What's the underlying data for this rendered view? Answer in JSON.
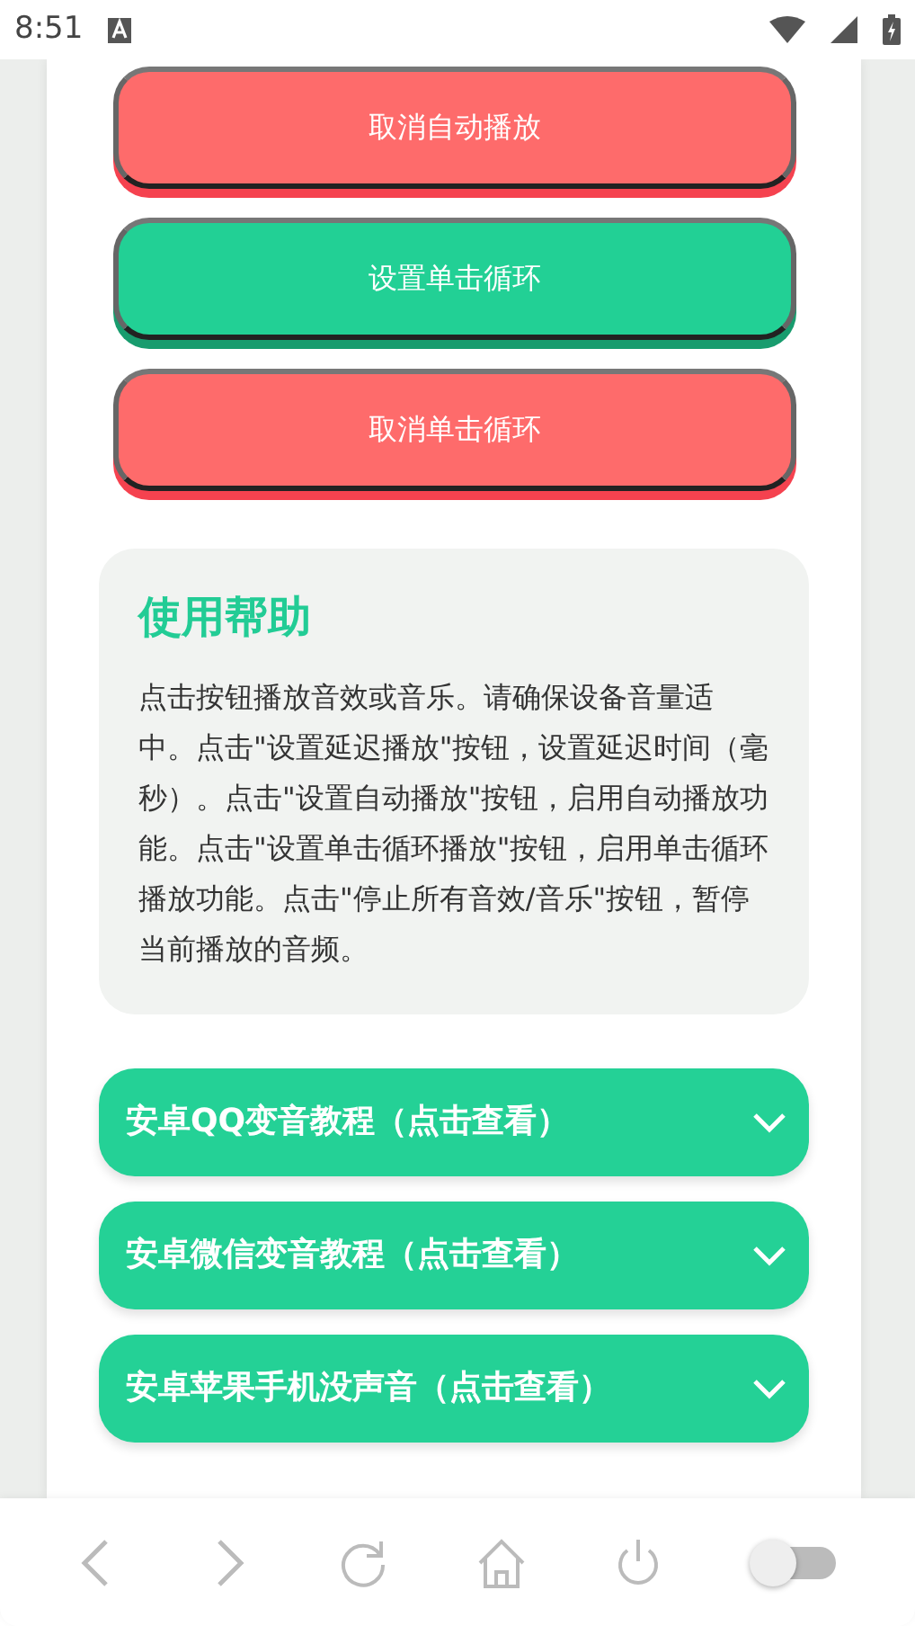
{
  "status_bar": {
    "time": "8:51"
  },
  "buttons": [
    {
      "label": "取消自动播放",
      "kind": "cancel"
    },
    {
      "label": "设置单击循环",
      "kind": "set"
    },
    {
      "label": "取消单击循环",
      "kind": "cancel"
    }
  ],
  "help": {
    "title": "使用帮助",
    "text": "点击按钮播放音效或音乐。请确保设备音量适中。点击\"设置延迟播放\"按钮，设置延迟时间（毫秒）。点击\"设置自动播放\"按钮，启用自动播放功能。点击\"设置单击循环播放\"按钮，启用单击循环播放功能。点击\"停止所有音效/音乐\"按钮，暂停当前播放的音频。"
  },
  "accordion": [
    {
      "title": "安卓QQ变音教程（点击查看）",
      "expanded": false
    },
    {
      "title": "安卓微信变音教程（点击查看）",
      "expanded": false
    },
    {
      "title": "安卓苹果手机没声音（点击查看）",
      "expanded": false
    }
  ],
  "bottom_nav": {
    "toggle": {
      "on": false
    }
  }
}
